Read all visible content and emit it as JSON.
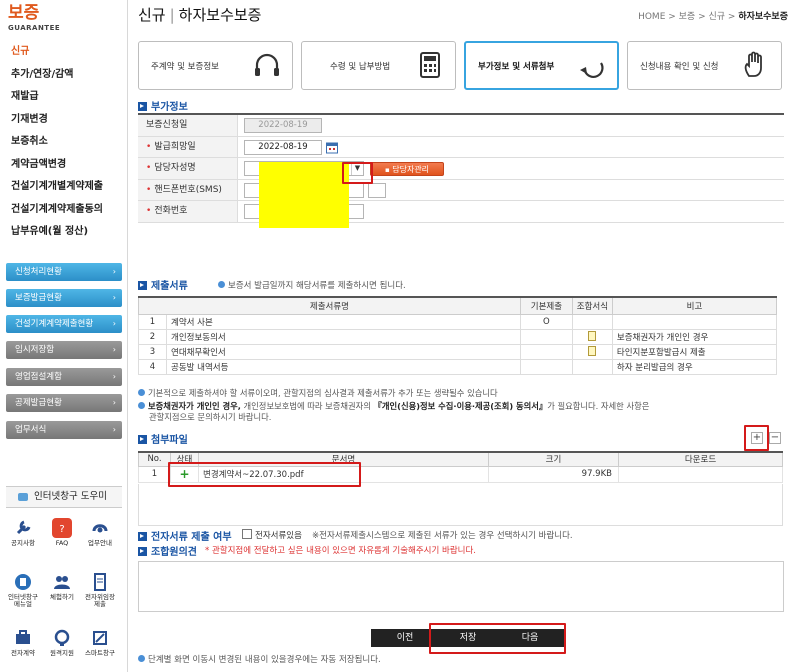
{
  "sidebar": {
    "logo_title": "보증",
    "logo_sub": "GUARANTEE",
    "menu": [
      "신규",
      "추가/연장/감액",
      "재발급",
      "기재변경",
      "보증취소",
      "계약금액변경",
      "건설기계개별계약제출",
      "건설기계계약제출동의",
      "납부유예(월 정산)"
    ],
    "active_index": 0,
    "buttons": [
      {
        "label": "신청처리현황",
        "style": "blue"
      },
      {
        "label": "보증발급현황",
        "style": "blue"
      },
      {
        "label": "건설기계계약제출현황",
        "style": "blue"
      },
      {
        "label": "임시저장함",
        "style": "gray"
      },
      {
        "label": "영업점설계함",
        "style": "gray"
      },
      {
        "label": "공제발급현황",
        "style": "gray"
      },
      {
        "label": "업무서식",
        "style": "gray"
      }
    ],
    "help_title": "인터넷창구 도우미",
    "help_icons": [
      {
        "label": "공지사항",
        "icon": "wrench-icon"
      },
      {
        "label": "FAQ",
        "icon": "faq-icon"
      },
      {
        "label": "업무안내",
        "icon": "phone-icon"
      },
      {
        "label": "인터넷창구 메뉴얼",
        "icon": "manual-icon"
      },
      {
        "label": "체험하기",
        "icon": "people-icon"
      },
      {
        "label": "전자위임장 제출",
        "icon": "document-icon"
      },
      {
        "label": "전자계약",
        "icon": "briefcase-icon"
      },
      {
        "label": "원격지원",
        "icon": "headset-icon"
      },
      {
        "label": "스마트창구",
        "icon": "pen-icon"
      }
    ]
  },
  "header": {
    "title_main": "신규",
    "title_sub": "하자보수보증",
    "breadcrumb": [
      "HOME",
      "보증",
      "신규",
      "하자보수보증"
    ]
  },
  "steps": [
    {
      "label": "주계약 및 보증정보",
      "icon": "headphones-icon",
      "active": false
    },
    {
      "label": "수령 및 납부방법",
      "icon": "calculator-icon",
      "active": false
    },
    {
      "label": "부가정보 및 서류첨부",
      "icon": "arrow-loop-icon",
      "active": true
    },
    {
      "label": "신청내용 확인 및 신청",
      "icon": "hand-icon",
      "active": false
    }
  ],
  "extra_info": {
    "section_title": "부가정보",
    "fields": [
      {
        "label": "보증신청일",
        "required": false,
        "value": "2022-08-19"
      },
      {
        "label": "발급희망일",
        "required": true,
        "value": "2022-08-19"
      },
      {
        "label": "담당자성명",
        "required": true,
        "value": "",
        "button": "담당자관리"
      },
      {
        "label": "핸드폰번호(SMS)",
        "required": true,
        "value": ""
      },
      {
        "label": "전화번호",
        "required": true,
        "value": ""
      }
    ]
  },
  "docs": {
    "section_title": "제출서류",
    "note": "보증서 발급일까지 해당서류를 제출하시면 됩니다.",
    "columns": [
      "제출서류명",
      "기본제출",
      "조합서식",
      "비고"
    ],
    "rows": [
      {
        "no": "1",
        "name": "계약서 사본",
        "basic": "O",
        "form": false,
        "remark": ""
      },
      {
        "no": "2",
        "name": "개인정보동의서",
        "basic": "",
        "form": true,
        "remark": "보증채권자가 개인인 경우"
      },
      {
        "no": "3",
        "name": "연대채무확인서",
        "basic": "",
        "form": true,
        "remark": "타인지분포함발급시 제출"
      },
      {
        "no": "4",
        "name": "공동발 내역서등",
        "basic": "",
        "form": false,
        "remark": "하자 분리발급의 경우"
      }
    ],
    "footnote1": "기본적으로 제출하셔야 할 서류이오며, 관할지점의 심사결과 제출서류가 추가 또는 생략될수 있습니다",
    "footnote2_bold": "보증채권자가 개인인 경우,",
    "footnote2_mid": " 개인정보보호법에 따라 보증채권자의 ",
    "footnote2_bold2": "『개인(신용)정보 수집·이용·제공(조회) 동의서』",
    "footnote2_end": "가 필요합니다. 자세한 사항은",
    "footnote2_line2": "관할지점으로 문의하시기 바랍니다."
  },
  "attachments": {
    "section_title": "첨부파일",
    "plus": "+",
    "minus": "−",
    "columns": [
      "No.",
      "상태",
      "문서명",
      "크기",
      "다운로드"
    ],
    "rows": [
      {
        "no": "1",
        "status": "+",
        "name": "변경계약서~22.07.30.pdf",
        "size": "97.9KB",
        "download": ""
      }
    ]
  },
  "e_docs": {
    "label": "전자서류 제출 여부",
    "checkbox_label": "전자서류있음",
    "note": "※전자서류제출시스템으로 제출된 서류가 있는 경우 선택하시기 바랍니다."
  },
  "opinion": {
    "label": "조합원의견",
    "note": "* 관할지점에 전달하고 싶은 내용이 있으면 자유롭게 기술해주시기 바랍니다."
  },
  "footer": {
    "prev": "이전",
    "save": "저장",
    "next": "다음",
    "note": "단계별 화면 이동시 변경된 내용이 있을경우에는 자동 저장됩니다."
  },
  "colors": {
    "accent_orange": "#e05a1e",
    "section_blue": "#1a55a4",
    "highlight_red": "#d41a1a",
    "mask_yellow": "#ffff00"
  }
}
